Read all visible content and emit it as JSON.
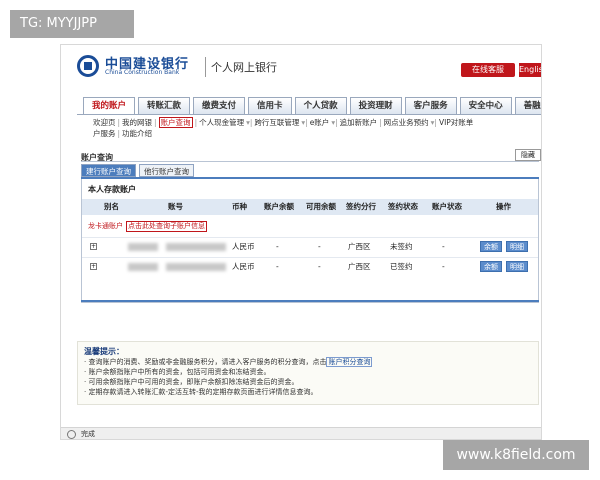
{
  "watermarks": {
    "top": "TG: MYYJJPP",
    "bottom": "www.k8field.com"
  },
  "header": {
    "bank_name_cn": "中国建设银行",
    "bank_name_en": "China Construction Bank",
    "subtitle": "个人网上银行",
    "customer_service": "在线客服",
    "lang": "English"
  },
  "tabs": [
    "我的账户",
    "转账汇款",
    "缴费支付",
    "信用卡",
    "个人贷款",
    "投资理财",
    "客户服务",
    "安全中心",
    "善融"
  ],
  "subnav": [
    "欢迎页",
    "我的网银",
    "账户查询",
    "个人现金管理",
    "跨行互联管理",
    "e账户",
    "追加新账户",
    "网点业务预约",
    "VIP对账单",
    "户服务",
    "功能介绍"
  ],
  "section": {
    "title": "账户查询",
    "hide": "隐藏"
  },
  "subtabs": [
    "建行账户查询",
    "他行账户查询"
  ],
  "panel": {
    "title": "本人存款账户"
  },
  "table": {
    "headers": [
      "别名",
      "账号",
      "币种",
      "账户余额",
      "可用余额",
      "签约分行",
      "签约状态",
      "账户状态",
      "操作"
    ],
    "notice_label": "龙卡通账户",
    "notice_link": "点击此处查询子账户信息",
    "rows": [
      {
        "currency": "人民币",
        "balance": "-",
        "available": "-",
        "branch": "广西区",
        "sign_status": "未签约",
        "account_status": "-",
        "actions": [
          "余额",
          "明细"
        ]
      },
      {
        "currency": "人民币",
        "balance": "-",
        "available": "-",
        "branch": "广西区",
        "sign_status": "已签约",
        "account_status": "-",
        "actions": [
          "余额",
          "明细"
        ]
      }
    ]
  },
  "tips": {
    "title": "温馨提示：",
    "items": [
      "查询账户的消费、奖励或非金融服务积分，请进入客户服务的积分查询，点击",
      "账户余额指账户中所有的资金，包括可用资金和冻结资金。",
      "可用余额指账户中可用的资金，即账户余额扣除冻结资金后的资金。",
      "定期存款请进入转账汇款-定活互转-我的定期存款页面进行详情信息查询。"
    ],
    "link": "账户积分查询"
  },
  "status": "完成"
}
